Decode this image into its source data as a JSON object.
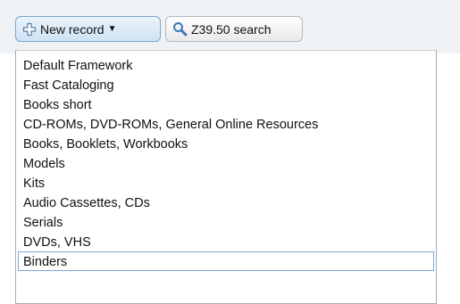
{
  "toolbar": {
    "new_record_label": "New record",
    "z3950_label": "Z39.50 search"
  },
  "menu": {
    "items": [
      "Default Framework",
      "Fast Cataloging",
      "Books short",
      "CD-ROMs, DVD-ROMs, General Online Resources",
      "Books, Booklets, Workbooks",
      "Models",
      "Kits",
      "Audio Cassettes, CDs",
      "Serials",
      "DVDs, VHS",
      "Binders"
    ],
    "highlighted_index": 10
  },
  "colors": {
    "toolbar_bg": "#eef2f5",
    "highlight_border": "#7aa8d6",
    "plus_icon": "#5a7fa8",
    "search_icon": "#3f78b5"
  }
}
